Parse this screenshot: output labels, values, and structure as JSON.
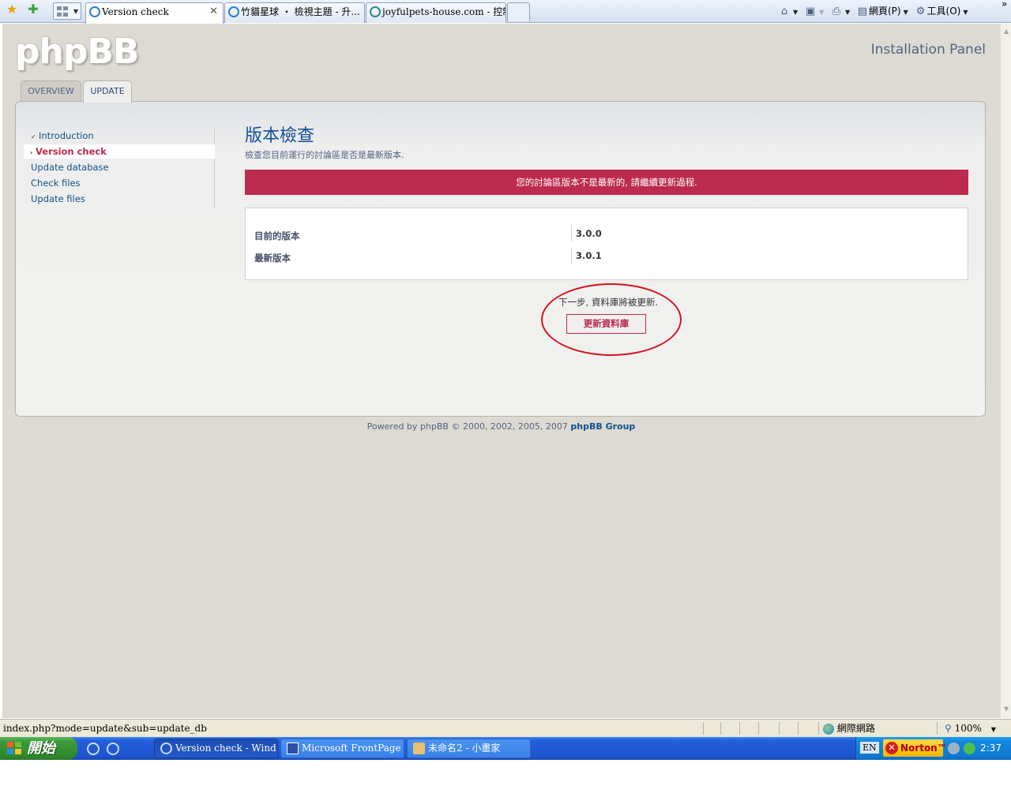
{
  "browser": {
    "tabs": [
      {
        "label": "Version check",
        "active": true
      },
      {
        "label": "竹貓星球 ‧ 檢視主題 - 升..."
      },
      {
        "label": "joyfulpets-house.com - 控制..."
      }
    ],
    "commands": {
      "page_label": "網頁(P)",
      "tools_label": "工具(O)"
    }
  },
  "header": {
    "logo_text": "phpBB",
    "panel_title": "Installation Panel"
  },
  "panel_tabs": [
    {
      "label": "OVERVIEW",
      "active": false
    },
    {
      "label": "UPDATE",
      "active": true
    }
  ],
  "menu": [
    {
      "label": "Introduction",
      "state": "done"
    },
    {
      "label": "Version check",
      "state": "current"
    },
    {
      "label": "Update database",
      "state": "pending"
    },
    {
      "label": "Check files",
      "state": "pending"
    },
    {
      "label": "Update files",
      "state": "pending"
    }
  ],
  "content": {
    "title": "版本檢查",
    "lead": "檢查您目前運行的討論區是否是最新版本.",
    "error_message": "您的討論區版本不是最新的, 請繼續更新過程.",
    "rows": [
      {
        "label": "目前的版本",
        "value": "3.0.0"
      },
      {
        "label": "最新版本",
        "value": "3.0.1"
      }
    ],
    "next_note": "下一步, 資料庫將被更新.",
    "submit_label": "更新資料庫"
  },
  "footer": {
    "text": "Powered by phpBB © 2000, 2002, 2005, 2007",
    "link": "phpBB Group"
  },
  "statusbar": {
    "url": "index.php?mode=update&sub=update_db",
    "zone": "網際網路",
    "zoom": "100%"
  },
  "taskbar": {
    "start_label": "開始",
    "tasks": [
      {
        "label": "Version check - Wind...",
        "active": true
      },
      {
        "label": "Microsoft FrontPage - ..."
      },
      {
        "label": "未命名2 - 小畫家"
      }
    ],
    "lang": "EN",
    "norton": "Norton™",
    "clock": "2:37"
  },
  "colors": {
    "accent_red": "#bc2a4d",
    "link_blue": "#105289",
    "annotation_red": "#d3121f"
  }
}
